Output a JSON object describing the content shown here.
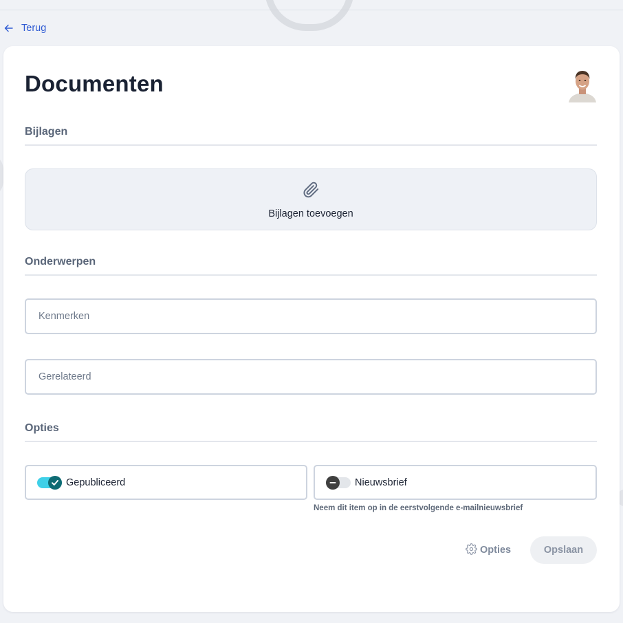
{
  "nav": {
    "back_label": "Terug"
  },
  "page": {
    "title": "Documenten"
  },
  "sections": {
    "attachments": {
      "heading": "Bijlagen",
      "dropzone_label": "Bijlagen toevoegen"
    },
    "topics": {
      "heading": "Onderwerpen",
      "tags_placeholder": "Kenmerken",
      "related_placeholder": "Gerelateerd"
    },
    "options": {
      "heading": "Opties",
      "published": {
        "label": "Gepubliceerd",
        "enabled": true
      },
      "newsletter": {
        "label": "Nieuwsbrief",
        "enabled": false,
        "helper": "Neem dit item op in de eerstvolgende e-mailnieuwsbrief"
      }
    }
  },
  "actions": {
    "options_label": "Opties",
    "save_label": "Opslaan"
  },
  "icons": {
    "back": "arrow-left-icon",
    "attach": "paperclip-icon",
    "check": "check-icon",
    "minus": "minus-icon",
    "settings": "gear-icon"
  },
  "colors": {
    "link": "#2f5bd3",
    "toggle_on_track": "#3fd0e8",
    "toggle_on_knob": "#0e6b73",
    "toggle_off_knob": "#3f3f3f"
  }
}
